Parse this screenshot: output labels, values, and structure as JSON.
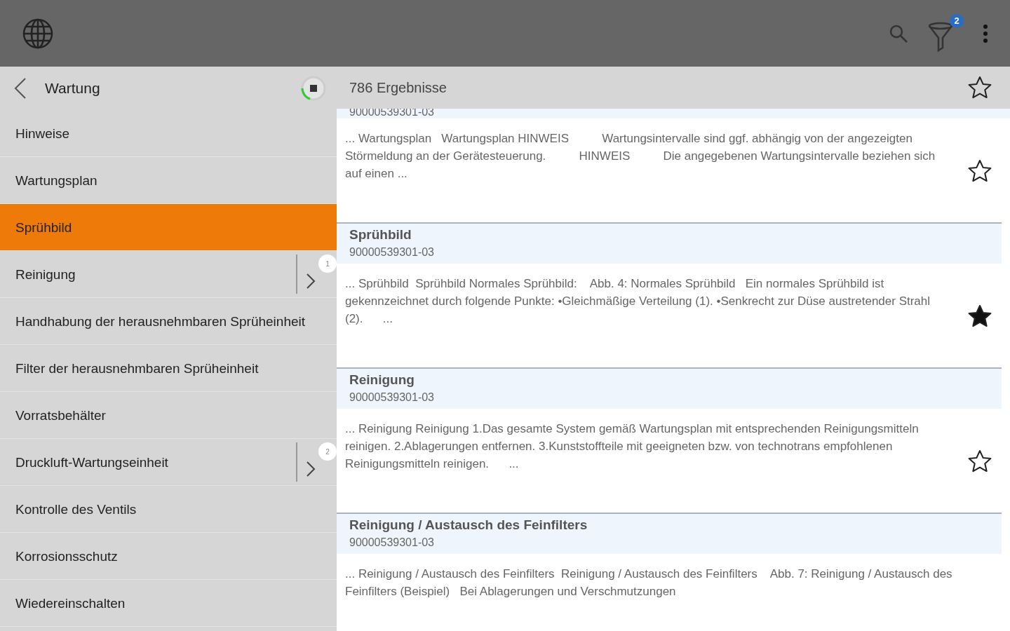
{
  "toolbar": {
    "filter_count": "2"
  },
  "sidebar": {
    "title": "Wartung",
    "items": [
      {
        "label": "Hinweise",
        "selected": false
      },
      {
        "label": "Wartungsplan",
        "selected": false
      },
      {
        "label": "Sprühbild",
        "selected": true
      },
      {
        "label": "Reinigung",
        "selected": false,
        "sub_count": "1"
      },
      {
        "label": "Handhabung der herausnehmbaren Sprüheinheit",
        "selected": false
      },
      {
        "label": "Filter der herausnehmbaren Sprüheinheit",
        "selected": false
      },
      {
        "label": "Vorratsbehälter",
        "selected": false
      },
      {
        "label": "Druckluft-Wartungseinheit",
        "selected": false,
        "sub_count": "2"
      },
      {
        "label": "Kontrolle des Ventils",
        "selected": false
      },
      {
        "label": "Korrosionsschutz",
        "selected": false
      },
      {
        "label": "Wiedereinschalten",
        "selected": false
      }
    ]
  },
  "results": {
    "count": "786 Ergebnisse",
    "favorite": false,
    "items": [
      {
        "doc_id": "90000539301-03",
        "excerpt": "... Wartungsplan   Wartungsplan HINWEIS          Wartungsintervalle sind ggf. abhängig von der angezeigten Störmeldung an der Gerätesteuerung.          HINWEIS          Die angegebenen Wartungsintervalle beziehen sich auf einen ...",
        "starred": false
      },
      {
        "title": "Sprühbild",
        "doc_id": "90000539301-03",
        "excerpt": "... Sprühbild  Sprühbild Normales Sprühbild:    Abb. 4: Normales Sprühbild   Ein normales Sprühbild ist gekennzeichnet durch folgende Punkte: •Gleichmäßige Verteilung (1). •Senkrecht zur Düse austretender Strahl (2).      ...",
        "starred": true
      },
      {
        "title": "Reinigung",
        "doc_id": "90000539301-03",
        "excerpt": "... Reinigung Reinigung 1.Das gesamte System gemäß Wartungsplan mit entsprechenden Reinigungsmitteln reinigen. 2.Ablagerungen entfernen. 3.Kunststoffteile mit geeigneten bzw. von technotrans empfohlenen Reinigungsmitteln reinigen.      ...",
        "starred": false
      },
      {
        "title": "Reinigung / Austausch des Feinfilters",
        "doc_id": "90000539301-03",
        "excerpt": "... Reinigung / Austausch des Feinfilters  Reinigung / Austausch des Feinfilters    Abb. 7: Reinigung / Austausch des Feinfilters (Beispiel)   Bei Ablagerungen und Verschmutzungen"
      }
    ]
  }
}
